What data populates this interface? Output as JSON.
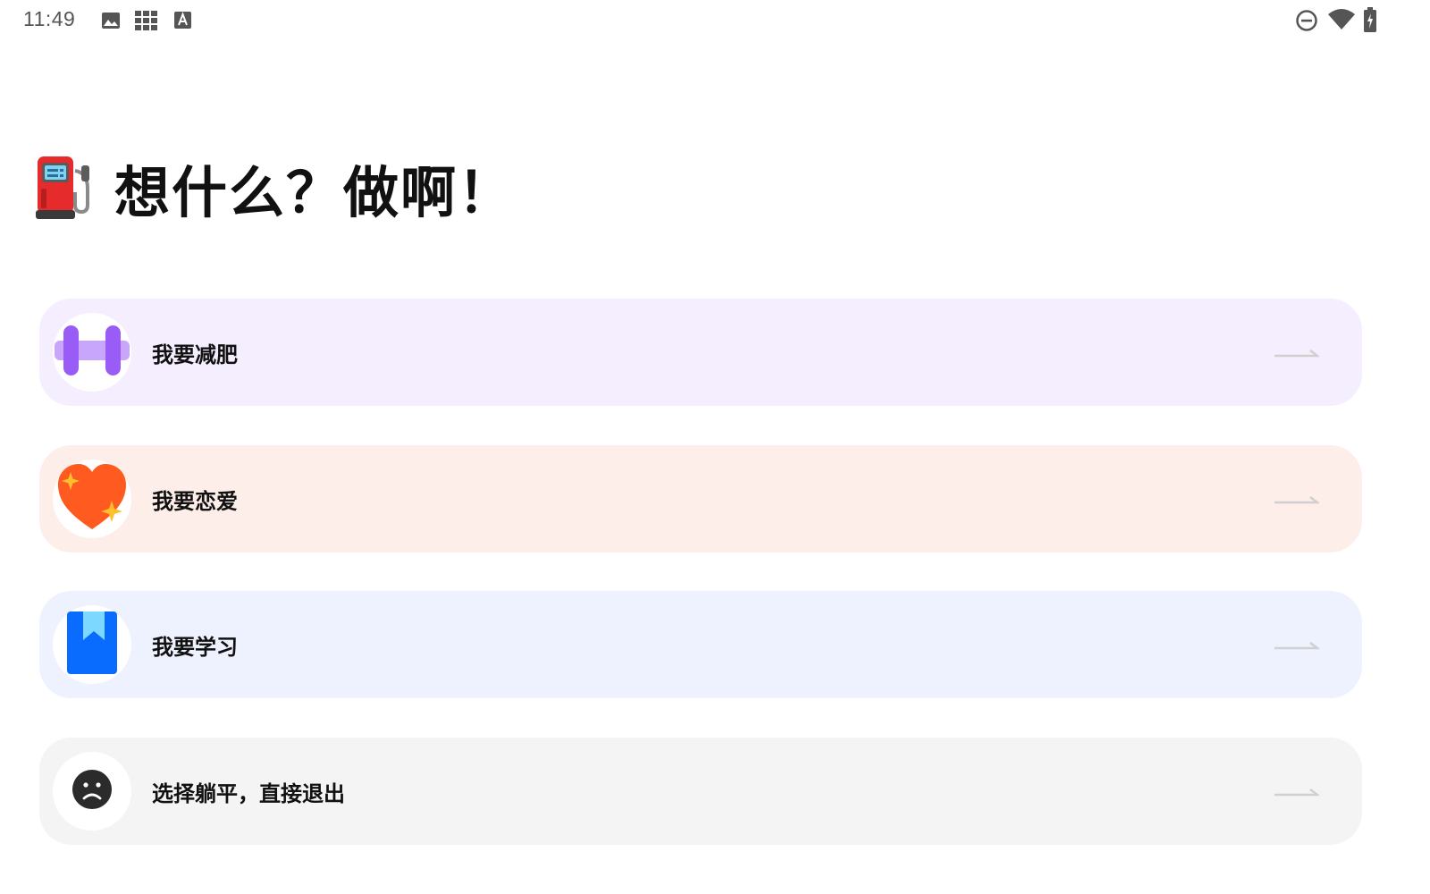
{
  "status_bar": {
    "time": "11:49",
    "left_icons": [
      "image-icon",
      "apps-grid-icon",
      "keyboard-a-icon"
    ],
    "right_icons": [
      "do-not-disturb-icon",
      "wifi-icon",
      "battery-charging-icon"
    ]
  },
  "header": {
    "icon": "fuel-pump-icon",
    "title": "想什么？做啊！"
  },
  "options": [
    {
      "label": "我要减肥",
      "icon": "dumbbell-icon",
      "bg": "#F4EEFE",
      "accent": "#9A5CF7"
    },
    {
      "label": "我要恋爱",
      "icon": "sparkling-heart-icon",
      "bg": "#FEEEEA",
      "accent": "#FF5A1F"
    },
    {
      "label": "我要学习",
      "icon": "bookmark-book-icon",
      "bg": "#EEF2FE",
      "accent": "#0A6CFF"
    },
    {
      "label": "选择躺平，直接退出",
      "icon": "sad-face-icon",
      "bg": "#F4F4F4",
      "accent": "#2B2B2B"
    }
  ],
  "arrow_icon": "arrow-right-icon",
  "colors": {
    "background": "#FFFFFF",
    "arrow": "#D0D0D0",
    "status_text": "#555555"
  }
}
